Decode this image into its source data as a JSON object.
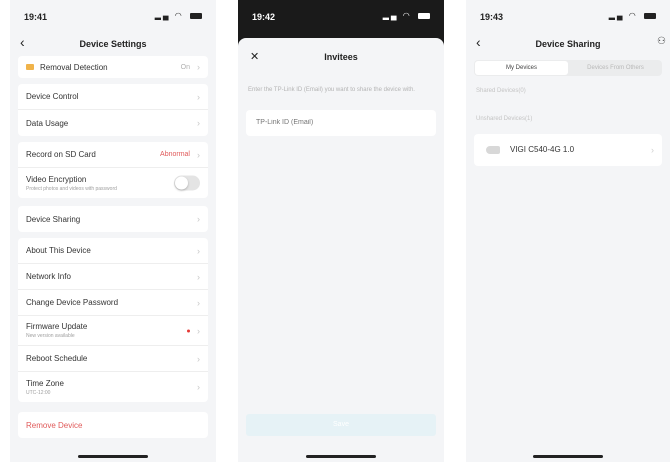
{
  "screens": {
    "settings": {
      "status_time": "19:41",
      "title": "Device Settings",
      "top_item": {
        "label": "Removal Detection",
        "value": "On"
      },
      "group1": [
        "Device Control",
        "Data Usage"
      ],
      "sd_card": {
        "label": "Record on SD Card",
        "value": "Abnormal"
      },
      "encryption": {
        "label": "Video Encryption",
        "sub": "Protect photos and videos with password"
      },
      "sharing": "Device Sharing",
      "group2": {
        "about": "About This Device",
        "network": "Network Info",
        "password": "Change Device Password",
        "firmware": {
          "label": "Firmware Update",
          "sub": "New version available"
        },
        "reboot": "Reboot Schedule",
        "timezone": {
          "label": "Time Zone",
          "sub": "UTC-12:00"
        }
      },
      "remove": "Remove Device"
    },
    "invitees": {
      "status_time": "19:42",
      "title": "Invitees",
      "hint": "Enter the TP-Link ID (Email) you want to share the device with.",
      "input_placeholder": "TP-Link ID (Email)",
      "cta": "Save"
    },
    "sharing": {
      "status_time": "19:43",
      "title": "Device Sharing",
      "tabs": [
        "My Devices",
        "Devices From Others"
      ],
      "shared_label": "Shared Devices(0)",
      "unshared_label": "Unshared Devices(1)",
      "device_name": "VIGI C540-4G 1.0"
    }
  },
  "colors": {
    "accent_red": "#e05a5a",
    "background": "#f4f5f7",
    "card": "#ffffff"
  },
  "icons": [
    "back-chevron-icon",
    "close-icon",
    "user-add-icon",
    "camera-icon",
    "chevron-right-icon"
  ]
}
